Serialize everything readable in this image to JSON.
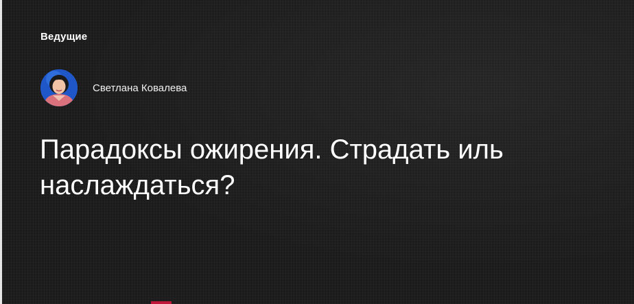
{
  "hosts_section": {
    "label": "Ведущие",
    "hosts": [
      {
        "name": "Светлана Ковалева",
        "avatar": "host-photo"
      }
    ]
  },
  "episode": {
    "title": "Парадоксы ожирения. Страдать иль наслаждаться?"
  },
  "colors": {
    "background": "#1b1b1b",
    "text": "#ffffff",
    "accent": "#c0163a"
  }
}
